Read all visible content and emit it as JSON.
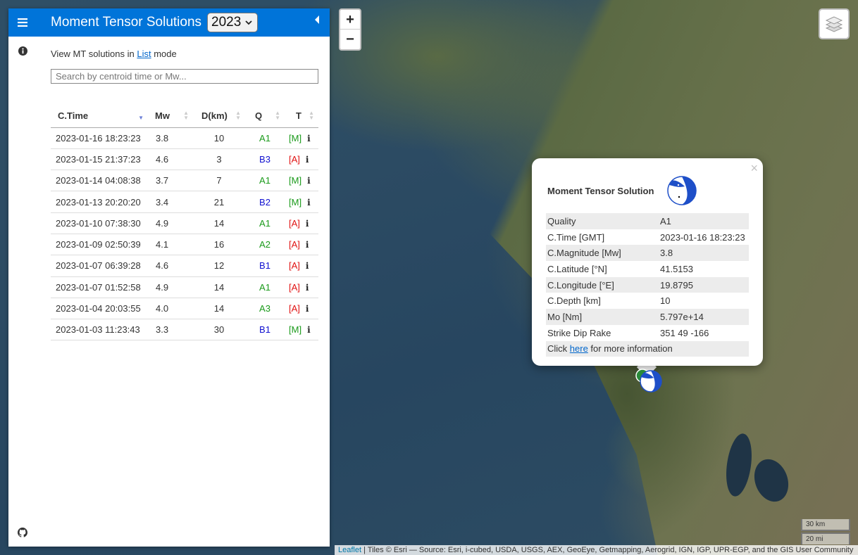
{
  "header": {
    "title": "Moment Tensor Solutions",
    "year": "2023"
  },
  "pane": {
    "mode_prefix": "View MT solutions in ",
    "mode_link": "List",
    "mode_suffix": " mode",
    "search_placeholder": "Search by centroid time or Mw..."
  },
  "table": {
    "headers": [
      "C.Time",
      "Mw",
      "D(km)",
      "Q",
      "T"
    ],
    "rows": [
      {
        "time": "2023-01-16 18:23:23",
        "mw": "3.8",
        "depth": "10",
        "q": "A1",
        "t": "[M]"
      },
      {
        "time": "2023-01-15 21:37:23",
        "mw": "4.6",
        "depth": "3",
        "q": "B3",
        "t": "[A]"
      },
      {
        "time": "2023-01-14 04:08:38",
        "mw": "3.7",
        "depth": "7",
        "q": "A1",
        "t": "[M]"
      },
      {
        "time": "2023-01-13 20:20:20",
        "mw": "3.4",
        "depth": "21",
        "q": "B2",
        "t": "[M]"
      },
      {
        "time": "2023-01-10 07:38:30",
        "mw": "4.9",
        "depth": "14",
        "q": "A1",
        "t": "[A]"
      },
      {
        "time": "2023-01-09 02:50:39",
        "mw": "4.1",
        "depth": "16",
        "q": "A2",
        "t": "[A]"
      },
      {
        "time": "2023-01-07 06:39:28",
        "mw": "4.6",
        "depth": "12",
        "q": "B1",
        "t": "[A]"
      },
      {
        "time": "2023-01-07 01:52:58",
        "mw": "4.9",
        "depth": "14",
        "q": "A1",
        "t": "[A]"
      },
      {
        "time": "2023-01-04 20:03:55",
        "mw": "4.0",
        "depth": "14",
        "q": "A3",
        "t": "[A]"
      },
      {
        "time": "2023-01-03 11:23:43",
        "mw": "3.3",
        "depth": "30",
        "q": "B1",
        "t": "[M]"
      }
    ]
  },
  "colors": {
    "quality_a": "#1a9a1a",
    "quality_b": "#1010d0",
    "type_m": "#1a9a1a",
    "type_a": "#e01010",
    "accent": "#0074d9"
  },
  "zoom": {
    "in": "+",
    "out": "−"
  },
  "popup": {
    "title": "Moment Tensor Solution",
    "close": "×",
    "rows": [
      {
        "k": "Quality",
        "v": "A1"
      },
      {
        "k": "C.Time [GMT]",
        "v": "2023-01-16 18:23:23"
      },
      {
        "k": "C.Magnitude [Mw]",
        "v": "3.8"
      },
      {
        "k": "C.Latitude [°N]",
        "v": "41.5153"
      },
      {
        "k": "C.Longitude [°E]",
        "v": "19.8795"
      },
      {
        "k": "C.Depth [km]",
        "v": "10"
      },
      {
        "k": "Mo [Nm]",
        "v": "5.797e+14"
      },
      {
        "k": "Strike Dip Rake",
        "v": "351 49 -166"
      }
    ],
    "more_prefix": "Click ",
    "more_link": "here",
    "more_suffix": " for more information"
  },
  "scale": {
    "km": "30 km",
    "mi": "20 mi"
  },
  "attribution": {
    "link": "Leaflet",
    "text": " | Tiles © Esri — Source: Esri, i-cubed, USDA, USGS, AEX, GeoEye, Getmapping, Aerogrid, IGN, IGP, UPR-EGP, and the GIS User Community"
  },
  "icons": [
    "menu-icon",
    "info-icon",
    "github-icon",
    "collapse-left-icon",
    "layers-icon",
    "row-info-icon"
  ]
}
